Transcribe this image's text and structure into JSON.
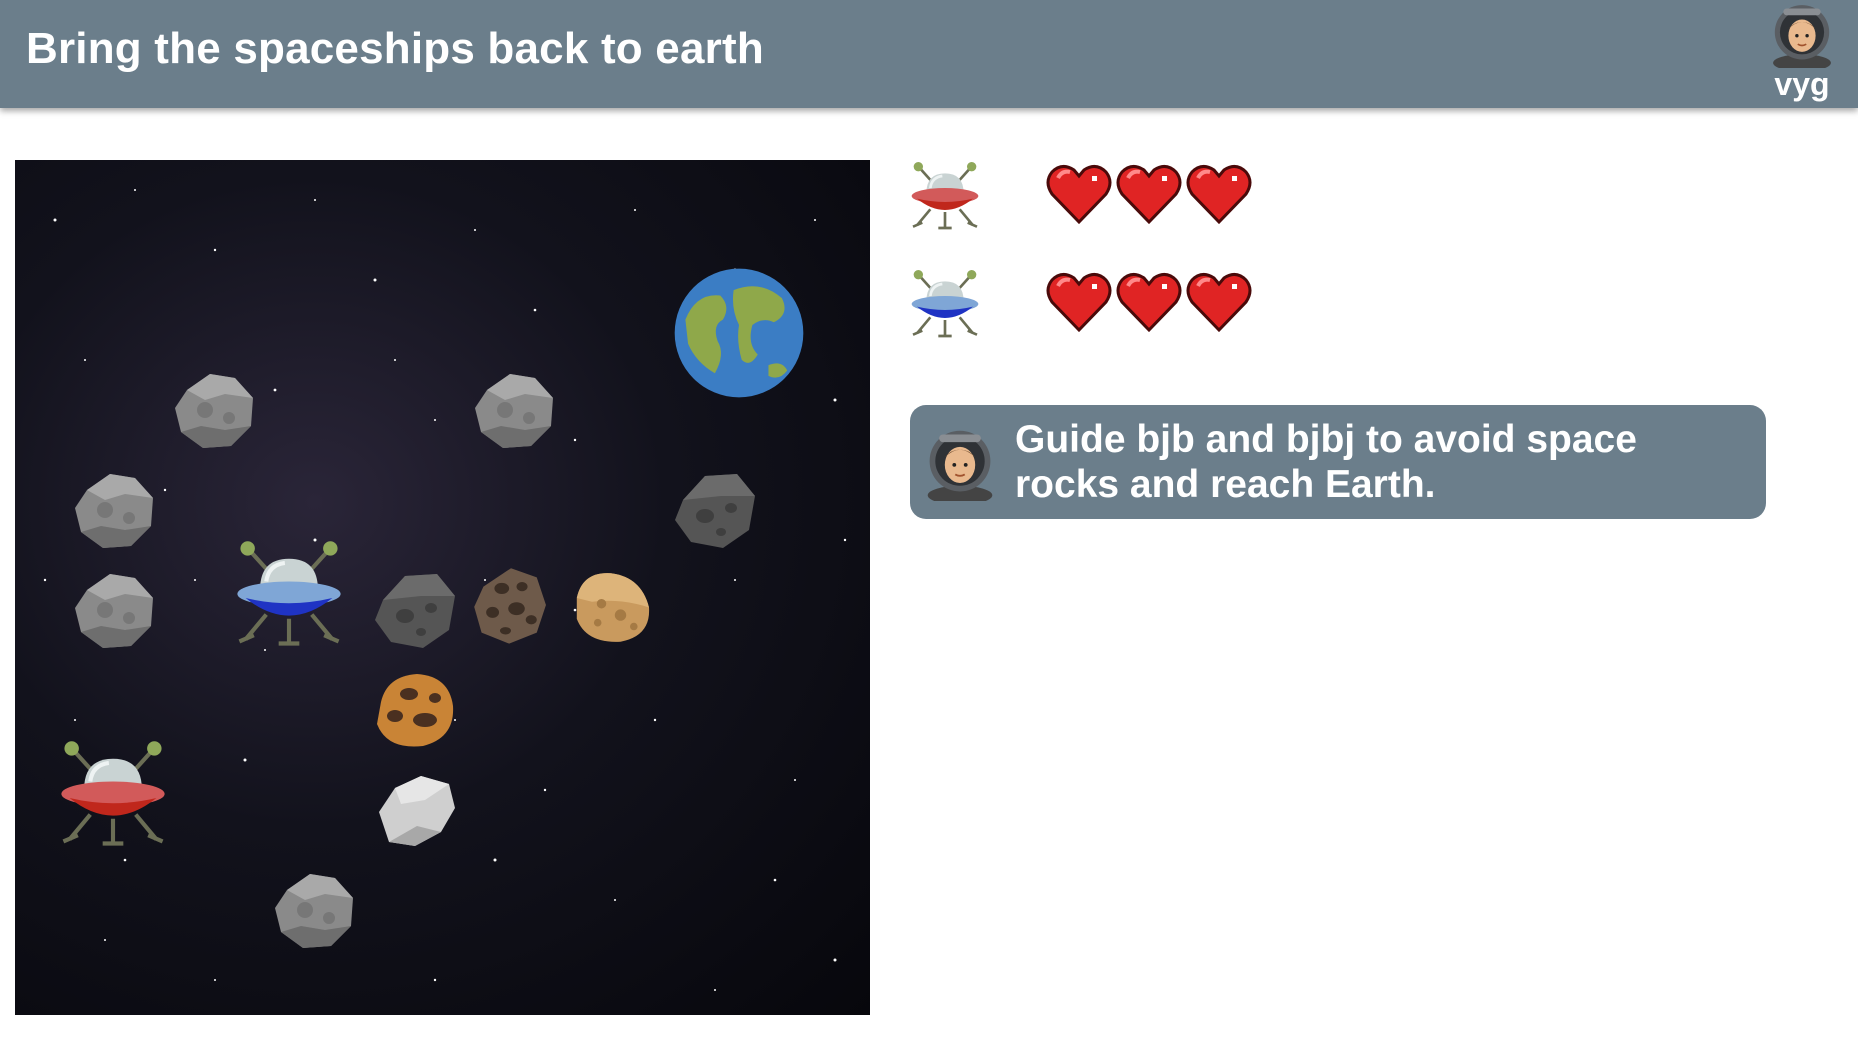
{
  "header": {
    "title": "Bring the spaceships back to earth",
    "user_name": "vyg",
    "avatar_icon": "astronaut-avatar-icon"
  },
  "game_board": {
    "background": "starfield-space",
    "goal": "earth-globe-icon",
    "ships": [
      {
        "name": "bjb",
        "color": "red",
        "icon": "red-ufo-icon"
      },
      {
        "name": "bjbj",
        "color": "blue",
        "icon": "blue-ufo-icon"
      }
    ],
    "rocks": [
      "gray-asteroid",
      "gray-asteroid",
      "gray-asteroid",
      "gray-asteroid",
      "dark-asteroid",
      "dark-asteroid",
      "brown-cratered-asteroid",
      "tan-asteroid",
      "orange-cratered-asteroid",
      "white-asteroid",
      "gray-asteroid"
    ]
  },
  "status": [
    {
      "ship": "red-ufo-icon",
      "lives": 3,
      "max_lives": 3
    },
    {
      "ship": "blue-ufo-icon",
      "lives": 3,
      "max_lives": 3
    }
  ],
  "instruction": {
    "avatar_icon": "astronaut-avatar-icon",
    "text": "Guide bjb and bjbj to avoid space rocks and reach Earth."
  },
  "colors": {
    "header_bg": "#6b7e8b",
    "heart_red": "#e02424",
    "ship_red": "#c0271c",
    "ship_blue": "#1f33c4"
  }
}
